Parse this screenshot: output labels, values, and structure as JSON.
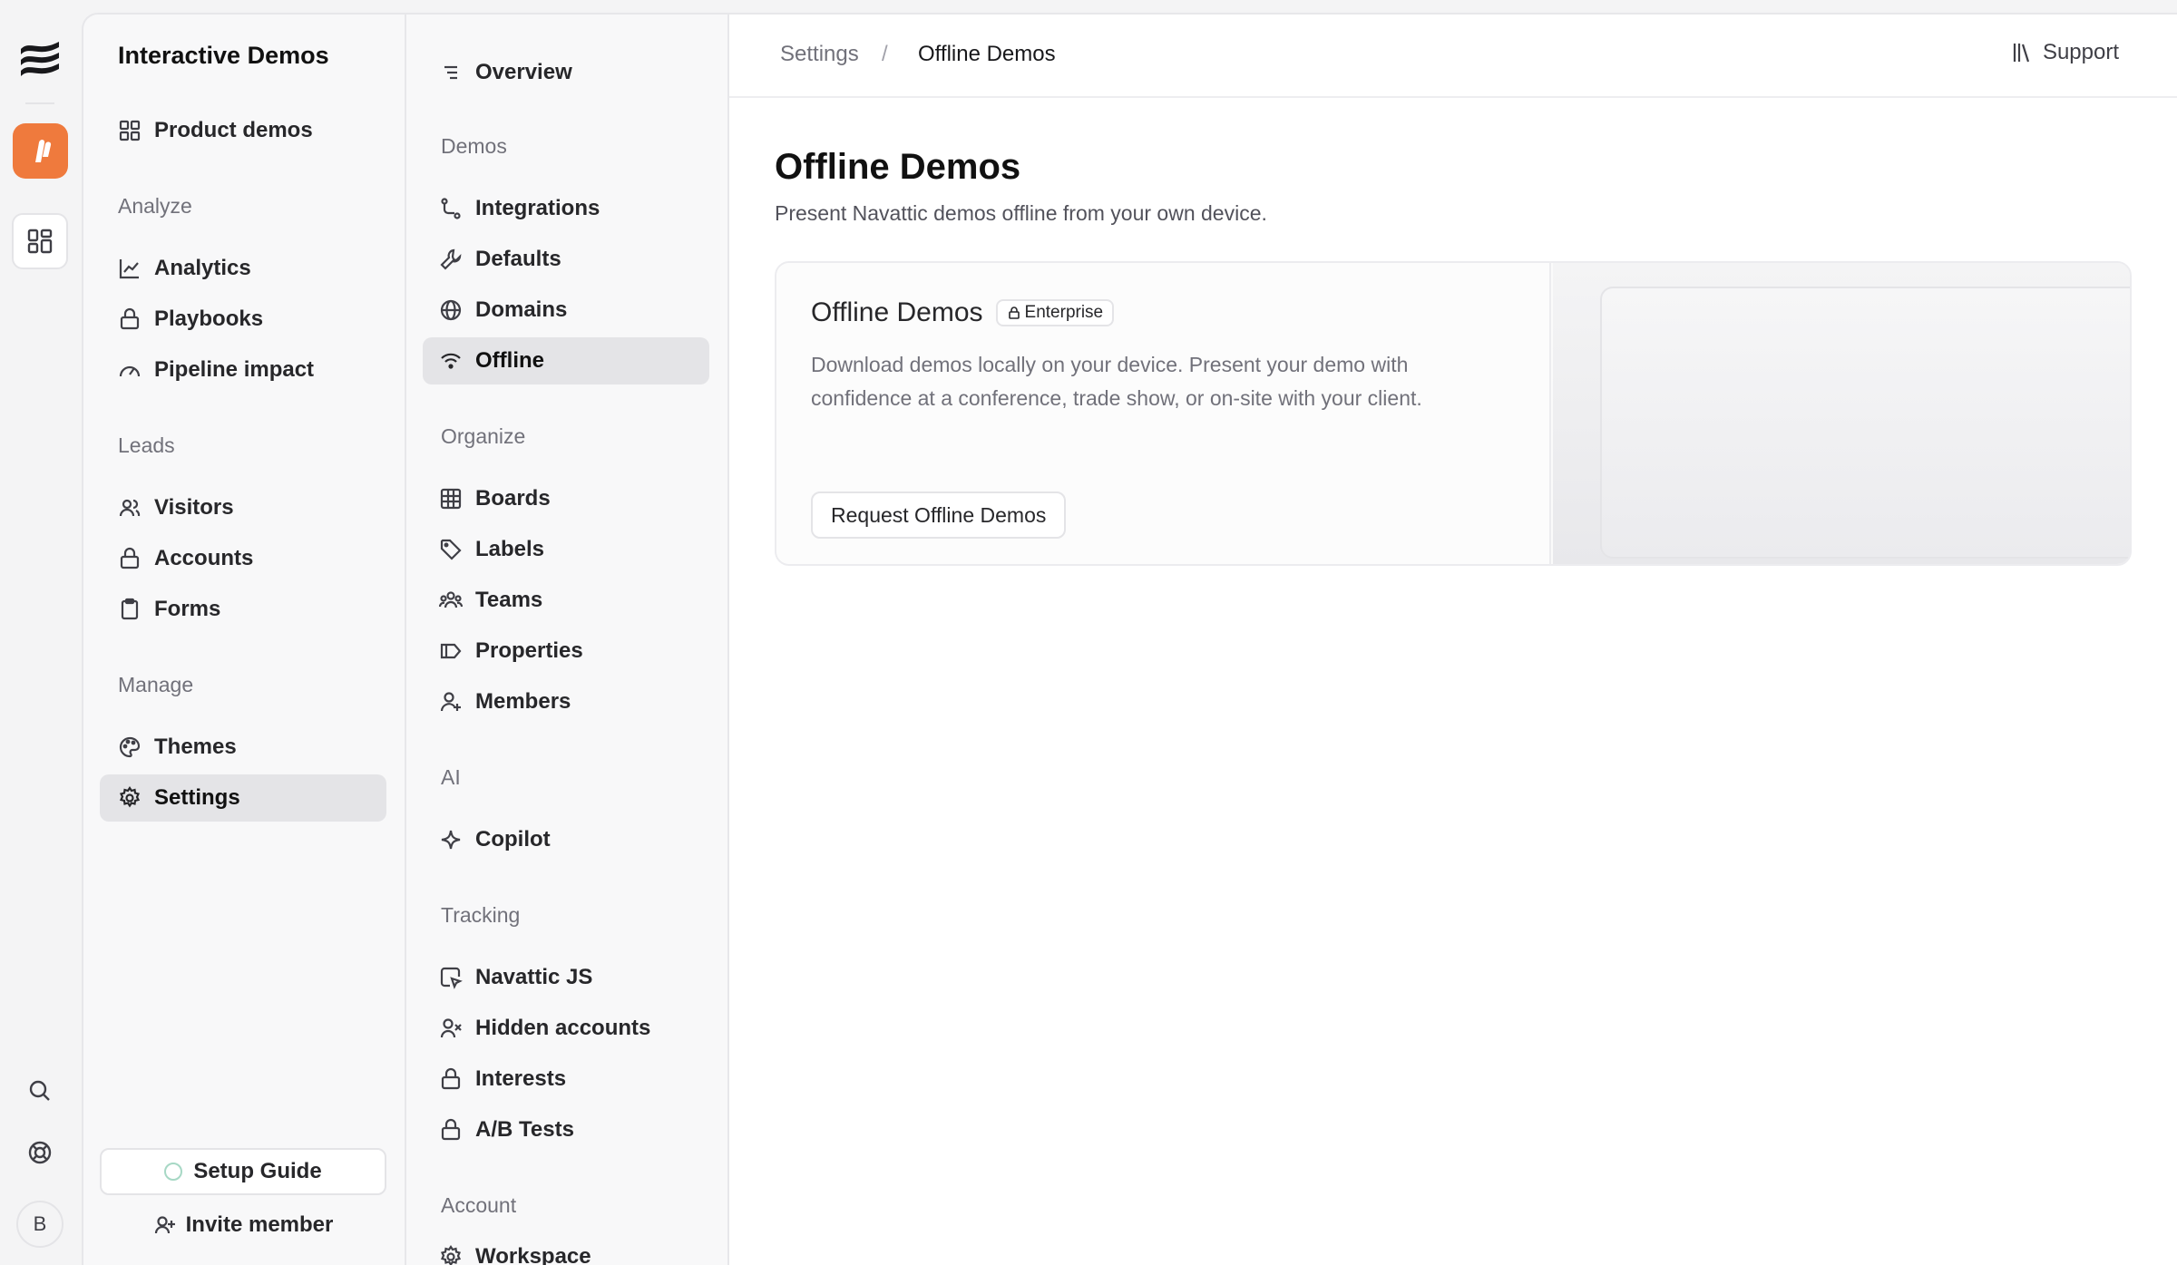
{
  "colors": {
    "accent": "#ef7a3d",
    "active_bg": "#e4e4e7"
  },
  "rail": {
    "avatar_initial": "B",
    "icons": [
      "navattic-logo-icon",
      "app-icon",
      "grid-icon",
      "search-icon",
      "help-lifebuoy-icon"
    ]
  },
  "nav": {
    "title": "Interactive Demos",
    "product_demos": "Product demos",
    "sections": {
      "analyze": "Analyze",
      "leads": "Leads",
      "manage": "Manage"
    },
    "analyze_items": [
      "Analytics",
      "Playbooks",
      "Pipeline impact"
    ],
    "leads_items": [
      "Visitors",
      "Accounts",
      "Forms"
    ],
    "manage_items": [
      "Themes",
      "Settings"
    ],
    "setup_guide": "Setup Guide",
    "invite_member": "Invite member"
  },
  "subnav": {
    "overview": "Overview",
    "sections": {
      "demos": "Demos",
      "organize": "Organize",
      "ai": "AI",
      "tracking": "Tracking",
      "account": "Account"
    },
    "demos_items": [
      "Integrations",
      "Defaults",
      "Domains",
      "Offline"
    ],
    "organize_items": [
      "Boards",
      "Labels",
      "Teams",
      "Properties",
      "Members"
    ],
    "ai_items": [
      "Copilot"
    ],
    "tracking_items": [
      "Navattic JS",
      "Hidden accounts",
      "Interests",
      "A/B Tests"
    ],
    "account_items": [
      "Workspace"
    ]
  },
  "breadcrumb": {
    "parent": "Settings",
    "separator": "/",
    "current": "Offline Demos"
  },
  "support": "Support",
  "page": {
    "title": "Offline Demos",
    "subtitle": "Present Navattic demos offline from your own device."
  },
  "card": {
    "title": "Offline Demos",
    "badge": "Enterprise",
    "description": "Download demos locally on your device. Present your demo with confidence at a conference, trade show, or on-site with your client.",
    "button": "Request Offline Demos"
  }
}
